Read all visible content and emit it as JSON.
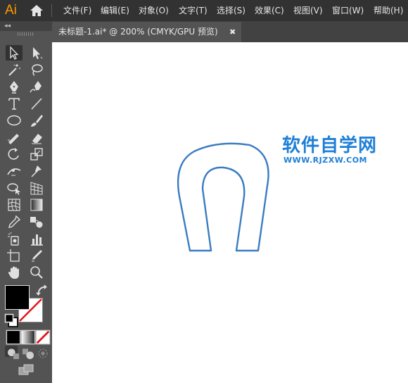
{
  "app": {
    "logo_text": "Ai"
  },
  "menu": [
    {
      "label": "文件(F)"
    },
    {
      "label": "编辑(E)"
    },
    {
      "label": "对象(O)"
    },
    {
      "label": "文字(T)"
    },
    {
      "label": "选择(S)"
    },
    {
      "label": "效果(C)"
    },
    {
      "label": "视图(V)"
    },
    {
      "label": "窗口(W)"
    },
    {
      "label": "帮助(H)"
    }
  ],
  "document_tab": {
    "title": "未标题-1.ai* @ 200% (CMYK/GPU 预览)",
    "close_glyph": "✖"
  },
  "panel": {
    "collapse_glyph": "◂◂"
  },
  "tools": [
    {
      "name": "selection-tool-icon"
    },
    {
      "name": "direct-selection-tool-icon"
    },
    {
      "name": "magic-wand-tool-icon"
    },
    {
      "name": "lasso-tool-icon"
    },
    {
      "name": "pen-tool-icon"
    },
    {
      "name": "curvature-tool-icon"
    },
    {
      "name": "type-tool-icon"
    },
    {
      "name": "line-segment-tool-icon"
    },
    {
      "name": "ellipse-tool-icon"
    },
    {
      "name": "paintbrush-tool-icon"
    },
    {
      "name": "shaper-tool-icon"
    },
    {
      "name": "eraser-tool-icon"
    },
    {
      "name": "rotate-tool-icon"
    },
    {
      "name": "scale-tool-icon"
    },
    {
      "name": "width-tool-icon"
    },
    {
      "name": "puppet-warp-tool-icon"
    },
    {
      "name": "shape-builder-tool-icon"
    },
    {
      "name": "perspective-grid-tool-icon"
    },
    {
      "name": "mesh-tool-icon"
    },
    {
      "name": "gradient-tool-icon"
    },
    {
      "name": "eyedropper-tool-icon"
    },
    {
      "name": "blend-tool-icon"
    },
    {
      "name": "symbol-sprayer-tool-icon"
    },
    {
      "name": "column-graph-tool-icon"
    },
    {
      "name": "artboard-tool-icon"
    },
    {
      "name": "slice-tool-icon"
    },
    {
      "name": "hand-tool-icon"
    },
    {
      "name": "zoom-tool-icon"
    }
  ],
  "colors": {
    "fill": "#000000",
    "stroke": "none",
    "path_stroke": "#3a7cc0",
    "watermark": "#1e7fd6",
    "accent_logo": "#ff9a00"
  },
  "watermark": {
    "title": "软件自学网",
    "url": "WWW.RJZXW.COM"
  }
}
